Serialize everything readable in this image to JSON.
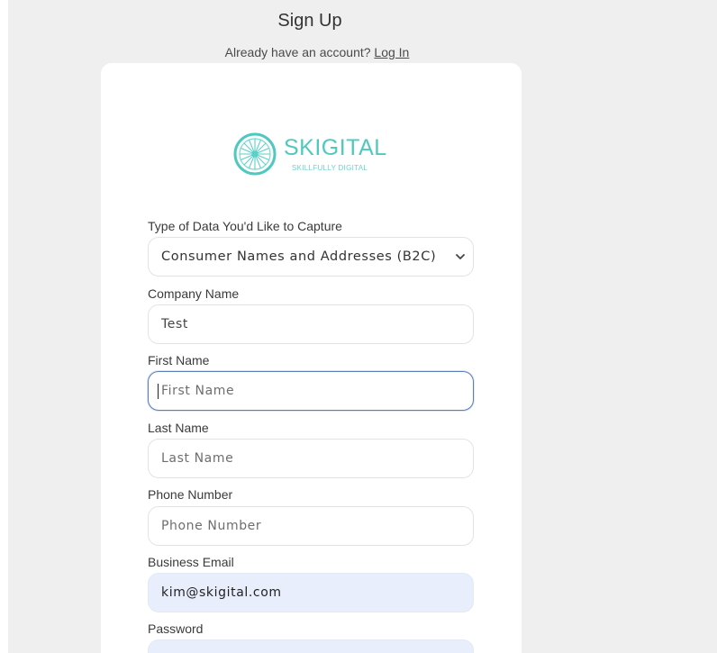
{
  "header": {
    "title": "Sign Up",
    "login_prompt": "Already have an account?",
    "login_link": "Log In"
  },
  "logo": {
    "name": "SKIGITAL",
    "tagline": "SKILLFULLY DIGITAL",
    "color": "#4fc9c0"
  },
  "form": {
    "data_type": {
      "label": "Type of Data You'd Like to Capture",
      "selected": "Consumer Names and Addresses (B2C)"
    },
    "company": {
      "label": "Company Name",
      "value": "Test",
      "placeholder": "Company Name"
    },
    "first_name": {
      "label": "First Name",
      "value": "",
      "placeholder": "First Name"
    },
    "last_name": {
      "label": "Last Name",
      "value": "",
      "placeholder": "Last Name"
    },
    "phone": {
      "label": "Phone Number",
      "value": "",
      "placeholder": "Phone Number"
    },
    "email": {
      "label": "Business Email",
      "value": "kim@skigital.com"
    },
    "password": {
      "label": "Password"
    }
  },
  "colors": {
    "page_background": "#efefef",
    "card_background": "#ffffff",
    "focus_border": "#5c7fb8",
    "autofill_background": "#e8eefb"
  }
}
